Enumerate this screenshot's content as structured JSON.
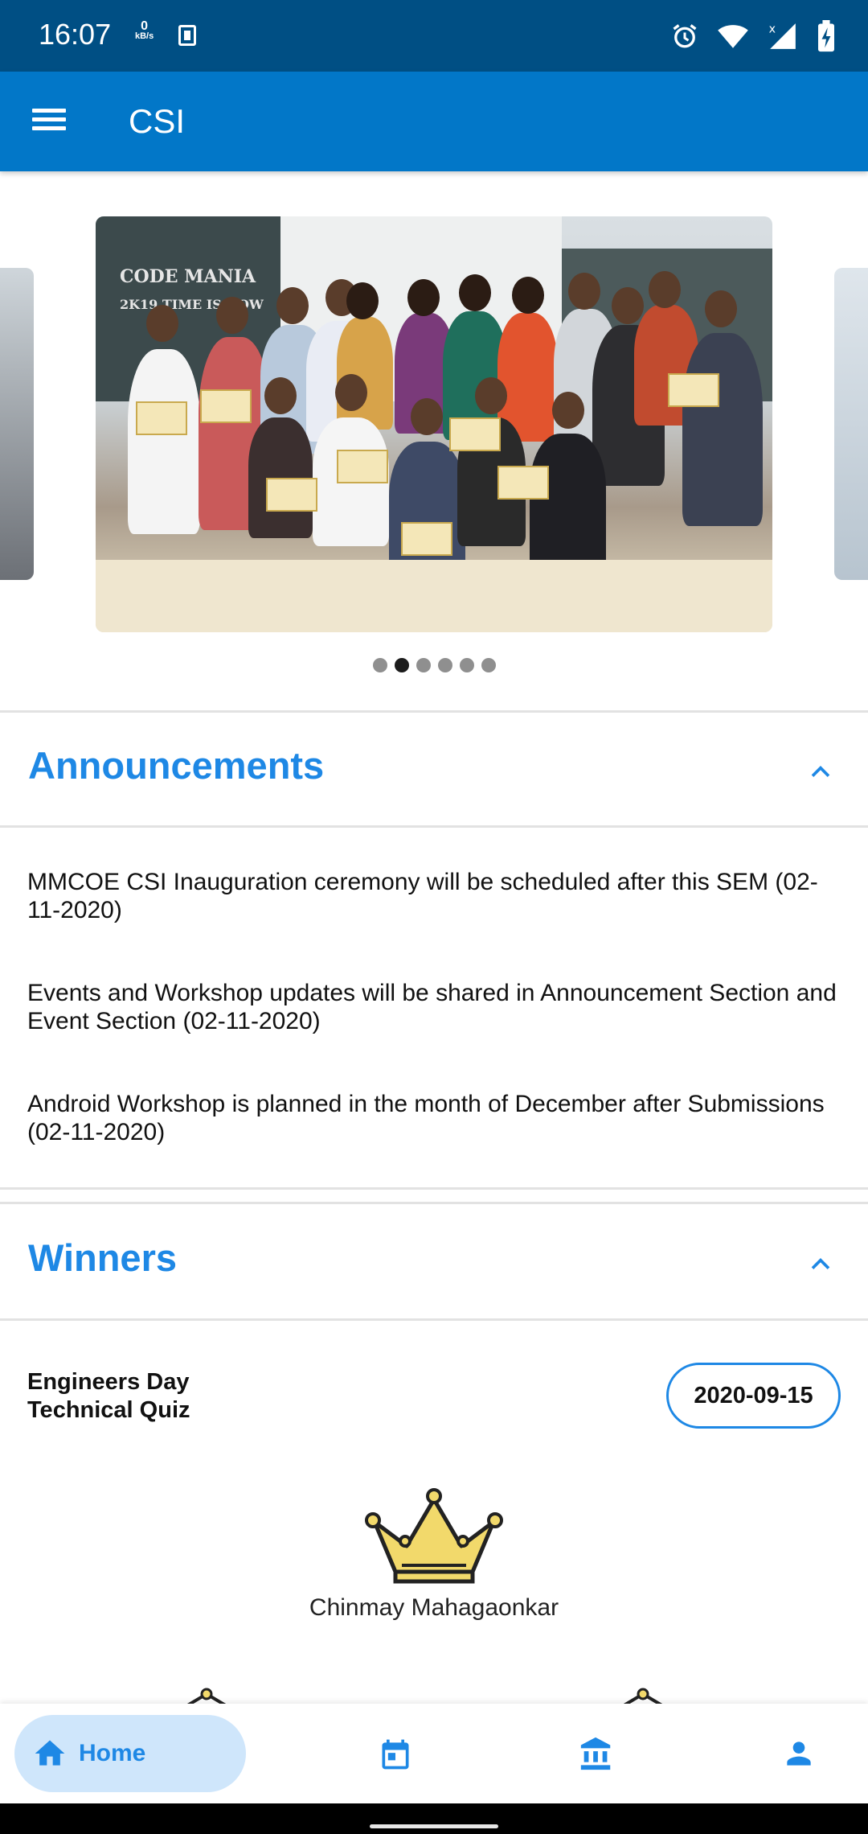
{
  "status_bar": {
    "time": "16:07",
    "net_speed_value": "0",
    "net_speed_unit": "kB/s",
    "battery": "charging"
  },
  "app_bar": {
    "title": "CSI"
  },
  "carousel": {
    "slide_board_text": "CODE MANIA",
    "slide_board_sub": "2K19  TIME IS NOW",
    "dot_count": 6,
    "active_index": 1
  },
  "announcements": {
    "title": "Announcements",
    "items": [
      "MMCOE CSI Inauguration ceremony will be scheduled after this SEM (02-11-2020)",
      "Events and Workshop updates will be shared in Announcement Section and Event Section (02-11-2020)",
      "Android Workshop is planned in the month of December after Submissions (02-11-2020)"
    ]
  },
  "winners": {
    "title": "Winners",
    "event_line1": "Engineers Day",
    "event_line2": "Technical Quiz",
    "date": "2020-09-15",
    "first_place": "Chinmay Mahagaonkar"
  },
  "bottom_nav": {
    "home_label": "Home"
  },
  "colors": {
    "status_bar": "#004f84",
    "app_bar": "#0277c8",
    "accent": "#1e88e5",
    "home_pill": "#cfe6fb",
    "crown": "#f2d96b"
  }
}
